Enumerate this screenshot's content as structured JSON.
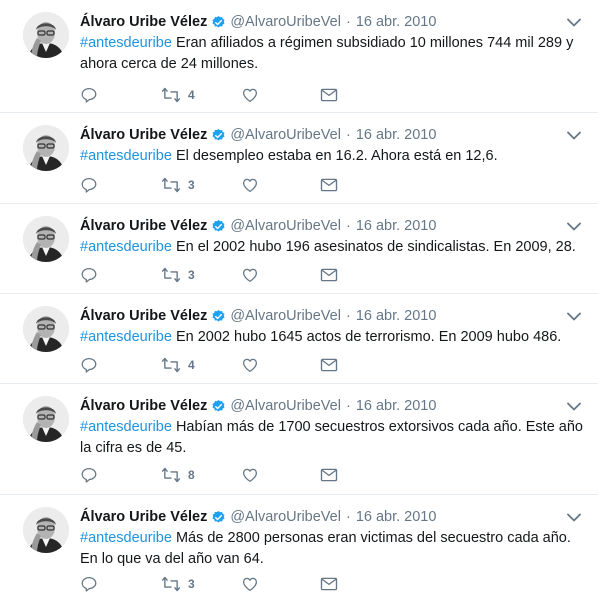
{
  "account": {
    "name": "Álvaro Uribe Vélez",
    "handle": "@AlvaroUribeVel",
    "verified_icon": "verified-badge-icon"
  },
  "colors": {
    "link": "#1b95e0",
    "secondary_text": "#657786",
    "divider": "#e6ecf0"
  },
  "tweets": [
    {
      "date": "16 abr. 2010",
      "hashtag": "#antesdeuribe",
      "text": " Eran afiliados a régimen subsidiado 10 millones 744 mil 289 y ahora cerca de 24 millones.",
      "retweets": "4"
    },
    {
      "date": "16 abr. 2010",
      "hashtag": "#antesdeuribe",
      "text": " El desempleo estaba en 16.2. Ahora está en 12,6.",
      "retweets": "3"
    },
    {
      "date": "16 abr. 2010",
      "hashtag": "#antesdeuribe",
      "text": " En el 2002 hubo 196 asesinatos de sindicalistas. En 2009, 28.",
      "retweets": "3"
    },
    {
      "date": "16 abr. 2010",
      "hashtag": "#antesdeuribe",
      "text": " En 2002 hubo 1645 actos de terrorismo. En 2009 hubo 486.",
      "retweets": "4"
    },
    {
      "date": "16 abr. 2010",
      "hashtag": "#antesdeuribe",
      "text": " Habían más de 1700 secuestros extorsivos cada año.  Este año la cifra es de 45.",
      "retweets": "8"
    },
    {
      "date": "16 abr. 2010",
      "hashtag": "#antesdeuribe",
      "text": " Más de 2800 personas eran victimas del secuestro cada año. En lo que va del año van 64.",
      "retweets": "3"
    }
  ]
}
